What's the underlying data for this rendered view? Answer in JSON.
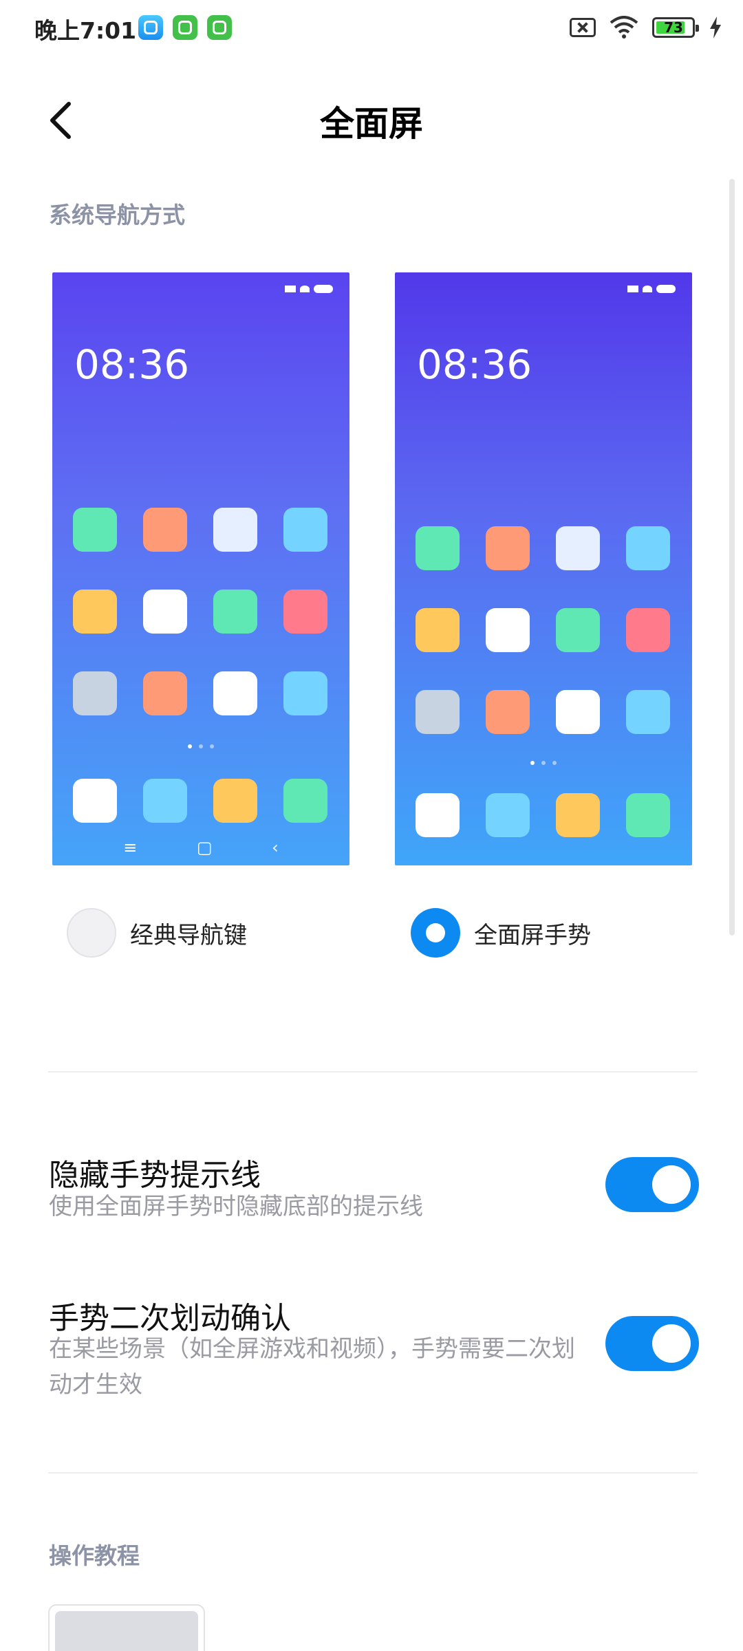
{
  "status_bar": {
    "time": "晚上7:01",
    "battery": "73",
    "icons": [
      "app-notification-icon",
      "wechat-icon",
      "wechat-icon",
      "sim-disabled-icon",
      "wifi-icon",
      "battery-icon",
      "charging-icon"
    ]
  },
  "header": {
    "title": "全面屏",
    "back_icon": "back-arrow-icon"
  },
  "navigation_section": {
    "label": "系统导航方式",
    "options": [
      {
        "label": "经典导航键",
        "selected": false,
        "preview_time": "08:36",
        "nav_keys": [
          "≡",
          "▢",
          "‹"
        ]
      },
      {
        "label": "全面屏手势",
        "selected": true,
        "preview_time": "08:36"
      }
    ]
  },
  "settings": [
    {
      "title": "隐藏手势提示线",
      "subtitle": "使用全面屏手势时隐藏底部的提示线",
      "enabled": true
    },
    {
      "title": "手势二次划动确认",
      "subtitle": "在某些场景（如全屏游戏和视频），手势需要二次划动才生效",
      "enabled": true
    }
  ],
  "tutorial_section": {
    "label": "操作教程"
  },
  "colors": {
    "accent": "#0d8af2",
    "section_label": "#8c93a6",
    "subtitle": "#9a9aa3",
    "app_green": "#5fe8b4",
    "app_orange": "#ff9a77",
    "app_white": "#ffffff",
    "app_lightblue": "#74d3ff",
    "app_yellow": "#ffc85c",
    "app_pink": "#ff7b8c",
    "app_gray": "#c7d3e0"
  }
}
